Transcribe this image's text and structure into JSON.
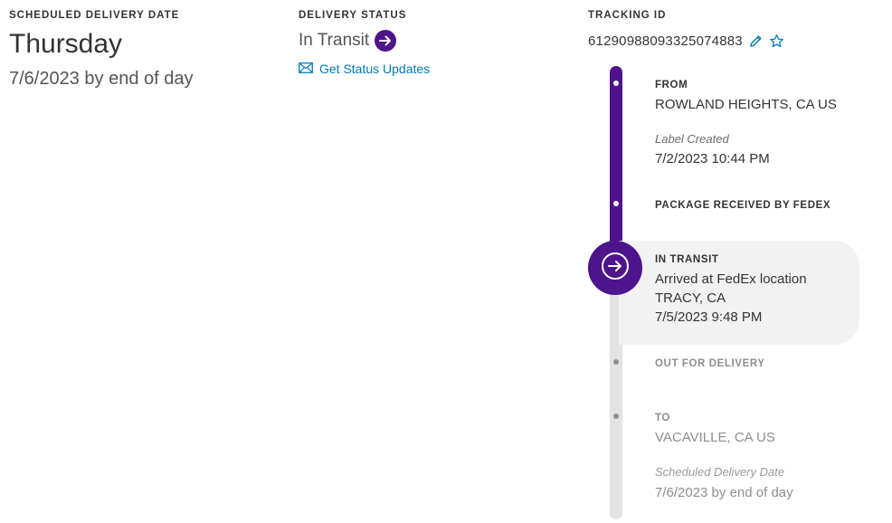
{
  "scheduled": {
    "label": "SCHEDULED DELIVERY DATE",
    "day": "Thursday",
    "date": "7/6/2023 by end of day"
  },
  "status": {
    "label": "DELIVERY STATUS",
    "value": "In Transit",
    "updates_link": "Get Status Updates"
  },
  "tracking": {
    "label": "TRACKING ID",
    "number": "612909880933250748​83",
    "number_display": "61290988093325074883"
  },
  "timeline": {
    "from": {
      "heading": "FROM",
      "location": "ROWLAND HEIGHTS, CA US",
      "sub_label": "Label Created",
      "datetime": "7/2/2023 10:44 PM"
    },
    "received": {
      "heading": "PACKAGE RECEIVED BY FEDEX"
    },
    "in_transit": {
      "heading": "IN TRANSIT",
      "line1": "Arrived at FedEx location",
      "line2": "TRACY, CA",
      "line3": "7/5/2023 9:48 PM"
    },
    "out_for_delivery": {
      "heading": "OUT FOR DELIVERY"
    },
    "to": {
      "heading": "TO",
      "location": "VACAVILLE, CA US",
      "sub_label": "Scheduled Delivery Date",
      "datetime": "7/6/2023 by end of day"
    }
  },
  "colors": {
    "brand_purple": "#4d148c",
    "link_blue": "#007ab7",
    "track_gray": "#e3e3e3"
  },
  "icons": {
    "status": "arrow-right-circle-icon",
    "updates": "envelope-icon",
    "edit": "pencil-icon",
    "favorite": "star-icon",
    "current": "arrow-right-circle-icon"
  }
}
